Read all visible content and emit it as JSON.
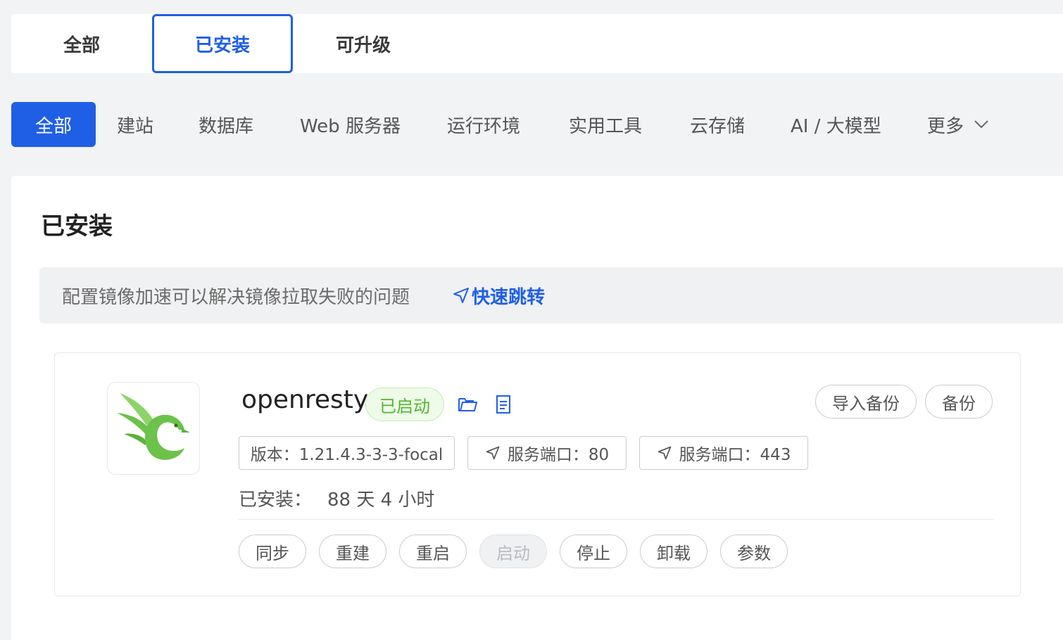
{
  "top_tabs": [
    {
      "label": "全部"
    },
    {
      "label": "已安装",
      "active": true
    },
    {
      "label": "可升级"
    }
  ],
  "categories": [
    {
      "label": "全部",
      "active": true
    },
    {
      "label": "建站"
    },
    {
      "label": "数据库"
    },
    {
      "label": "Web 服务器"
    },
    {
      "label": "运行环境"
    },
    {
      "label": "实用工具"
    },
    {
      "label": "云存储"
    },
    {
      "label": "AI / 大模型"
    },
    {
      "label": "更多",
      "icon": "chevron-down-icon"
    }
  ],
  "panel": {
    "title": "已安装",
    "notice": {
      "text": "配置镜像加速可以解决镜像拉取失败的问题",
      "link_label": "快速跳转",
      "link_icon": "send-arrow-icon"
    }
  },
  "app": {
    "name": "openresty",
    "status": "已启动",
    "logo_icon": "openresty-bird-logo",
    "folder_icon": "folder-icon",
    "log_icon": "document-icon",
    "buttons": {
      "import_backup": "导入备份",
      "backup": "备份"
    },
    "tags": {
      "version": "版本：1.21.4.3-3-3-focal",
      "port1": "服务端口：80",
      "port2": "服务端口：443"
    },
    "installed_label": "已安装：",
    "installed_value": "88 天 4 小时",
    "actions": [
      {
        "label": "同步"
      },
      {
        "label": "重建"
      },
      {
        "label": "重启"
      },
      {
        "label": "启动",
        "disabled": true
      },
      {
        "label": "停止"
      },
      {
        "label": "卸载"
      },
      {
        "label": "参数"
      }
    ]
  },
  "colors": {
    "accent": "#1f5fe6",
    "status_green": "#52b52f",
    "logo_green": "#6cc24a"
  }
}
